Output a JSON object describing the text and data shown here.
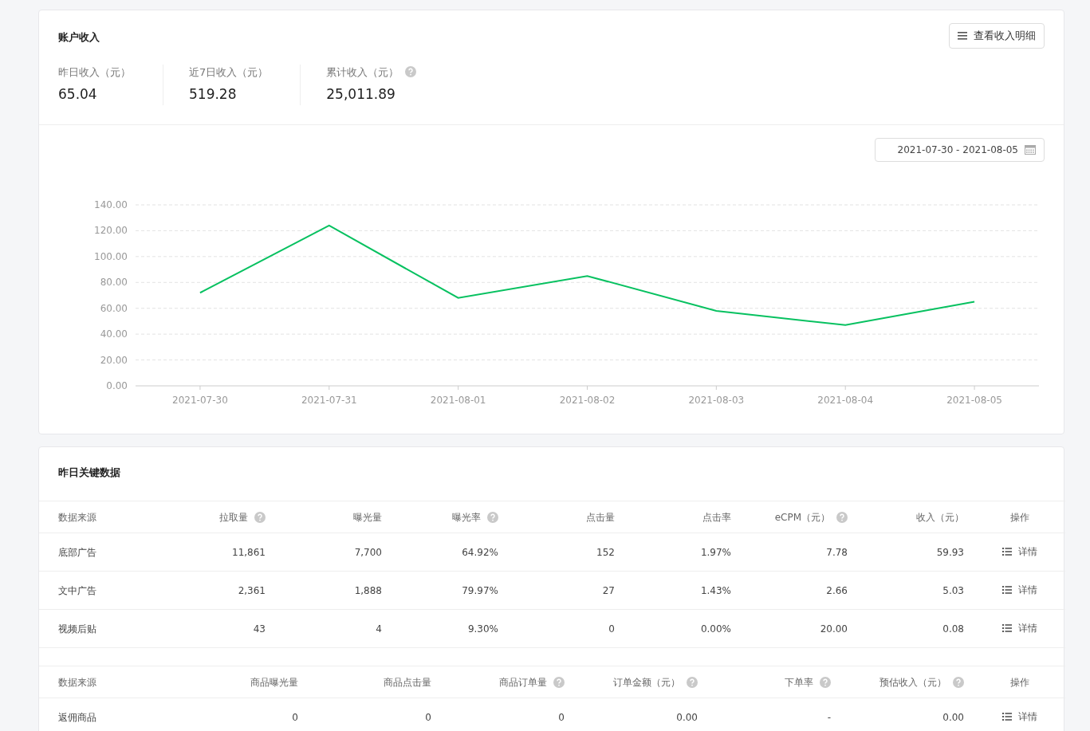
{
  "income_card": {
    "title": "账户收入",
    "detail_button": "查看收入明细",
    "stats": [
      {
        "label": "昨日收入（元）",
        "value": "65.04",
        "help": false
      },
      {
        "label": "近7日收入（元）",
        "value": "519.28",
        "help": false
      },
      {
        "label": "累计收入（元）",
        "value": "25,011.89",
        "help": true
      }
    ],
    "date_range": "2021-07-30 - 2021-08-05",
    "chart_data": {
      "type": "line",
      "categories": [
        "2021-07-30",
        "2021-07-31",
        "2021-08-01",
        "2021-08-02",
        "2021-08-03",
        "2021-08-04",
        "2021-08-05"
      ],
      "series": [
        {
          "color": "#07c160",
          "values": [
            72,
            124,
            68,
            85,
            58,
            47,
            65
          ]
        }
      ],
      "grid": true,
      "ylim": [
        0,
        140
      ],
      "yticks": [
        {
          "value": 0,
          "label": "0.00"
        },
        {
          "value": 20,
          "label": "20.00"
        },
        {
          "value": 40,
          "label": "40.00"
        },
        {
          "value": 60,
          "label": "60.00"
        },
        {
          "value": 80,
          "label": "80.00"
        },
        {
          "value": 100,
          "label": "100.00"
        },
        {
          "value": 120,
          "label": "120.00"
        },
        {
          "value": 140,
          "label": "140.00"
        }
      ]
    }
  },
  "key_data_card": {
    "title": "昨日关键数据",
    "tables": [
      {
        "columns": [
          {
            "label": "数据来源",
            "help": false
          },
          {
            "label": "拉取量",
            "help": true
          },
          {
            "label": "曝光量",
            "help": false
          },
          {
            "label": "曝光率",
            "help": true
          },
          {
            "label": "点击量",
            "help": false
          },
          {
            "label": "点击率",
            "help": false
          },
          {
            "label": "eCPM（元）",
            "help": true
          },
          {
            "label": "收入（元）",
            "help": false
          },
          {
            "label": "操作",
            "help": false
          }
        ],
        "rows": [
          {
            "cells": [
              "底部广告",
              "11,861",
              "7,700",
              "64.92%",
              "152",
              "1.97%",
              "7.78",
              "59.93"
            ],
            "action": "详情"
          },
          {
            "cells": [
              "文中广告",
              "2,361",
              "1,888",
              "79.97%",
              "27",
              "1.43%",
              "2.66",
              "5.03"
            ],
            "action": "详情"
          },
          {
            "cells": [
              "视频后贴",
              "43",
              "4",
              "9.30%",
              "0",
              "0.00%",
              "20.00",
              "0.08"
            ],
            "action": "详情"
          }
        ]
      },
      {
        "columns": [
          {
            "label": "数据来源",
            "help": false
          },
          {
            "label": "商品曝光量",
            "help": false
          },
          {
            "label": "商品点击量",
            "help": false
          },
          {
            "label": "商品订单量",
            "help": true
          },
          {
            "label": "订单金额（元）",
            "help": true
          },
          {
            "label": "下单率",
            "help": true
          },
          {
            "label": "预估收入（元）",
            "help": true
          },
          {
            "label": "操作",
            "help": false
          }
        ],
        "rows": [
          {
            "cells": [
              "返佣商品",
              "0",
              "0",
              "0",
              "0.00",
              "-",
              "0.00"
            ],
            "action": "详情"
          }
        ]
      }
    ]
  }
}
